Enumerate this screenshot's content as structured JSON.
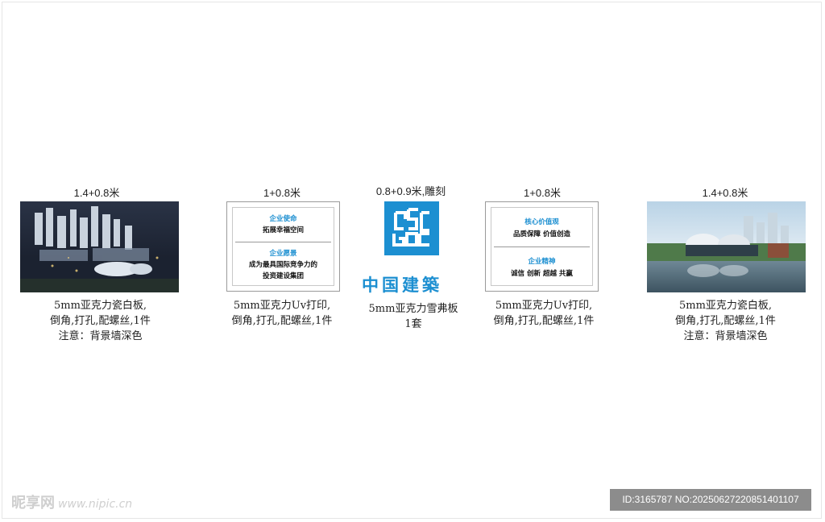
{
  "panels": [
    {
      "size": "1.4+0.8米",
      "desc": [
        "5mm亚克力瓷白板,",
        "倒角,打孔,配螺丝,1件",
        "注意：背景墙深色"
      ]
    },
    {
      "size": "1+0.8米",
      "desc": [
        "5mm亚克力Uv打印,",
        "倒角,打孔,配螺丝,1件"
      ],
      "card": {
        "title1": "企业使命",
        "text1": "拓展幸福空间",
        "title2": "企业愿景",
        "text2a": "成为最具国际竞争力的",
        "text2b": "投资建设集团"
      }
    },
    {
      "size": "0.8+0.9米,雕刻",
      "desc": [
        "5mm亚克力雪弗板",
        "1套"
      ],
      "wordmark": "中国建築"
    },
    {
      "size": "1+0.8米",
      "desc": [
        "5mm亚克力Uv打印,",
        "倒角,打孔,配螺丝,1件"
      ],
      "card": {
        "title1": "核心价值观",
        "text1": "品质保障  价值创造",
        "title2": "企业精神",
        "text2a": "诚信  创新  超越  共赢"
      }
    },
    {
      "size": "1.4+0.8米",
      "desc": [
        "5mm亚克力瓷白板,",
        "倒角,打孔,配螺丝,1件",
        "注意：背景墙深色"
      ]
    }
  ],
  "watermark": {
    "brand": "昵享网",
    "site": "www.nipic.cn"
  },
  "id_bar": "ID:3165787 NO:20250627220851401107",
  "colors": {
    "accent": "#1c8fd1",
    "id_bar_bg": "#8c8c8c"
  }
}
